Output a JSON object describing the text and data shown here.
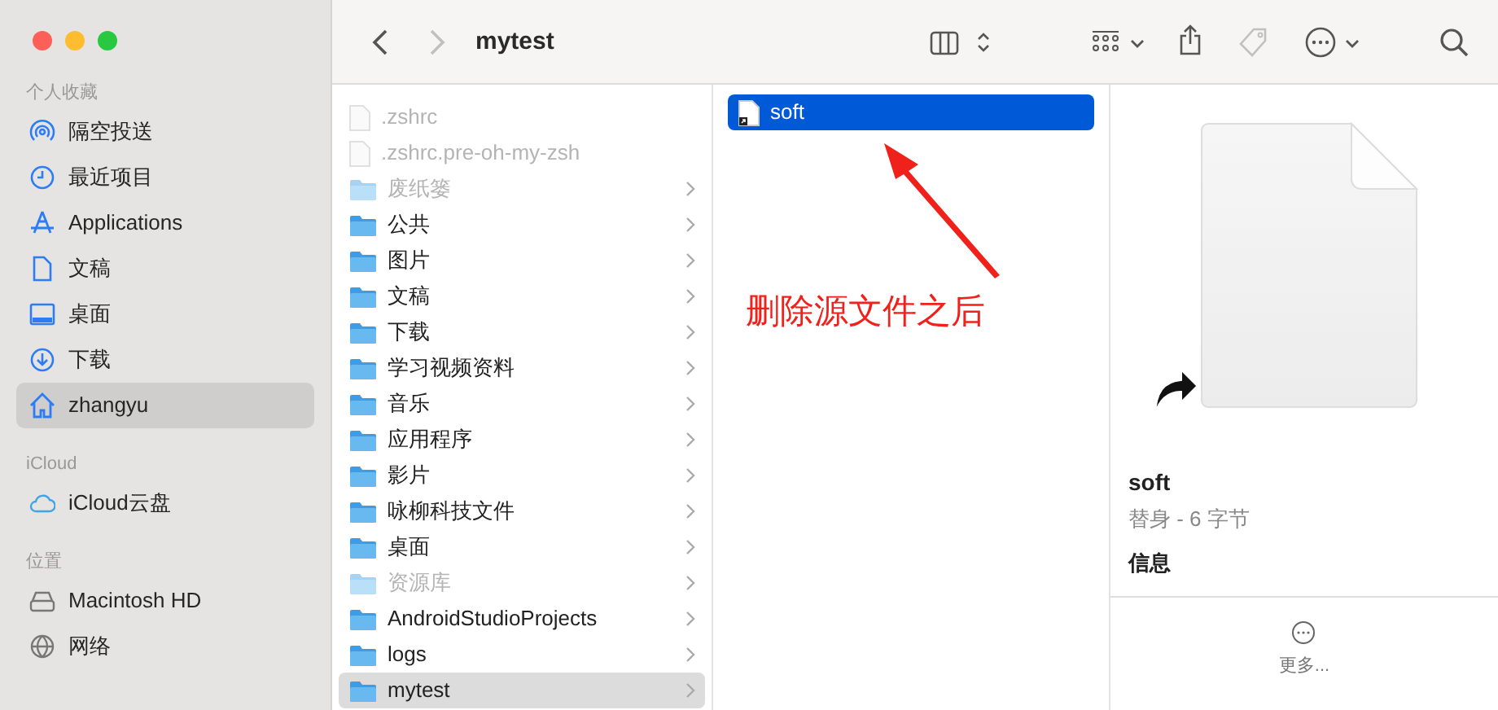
{
  "window": {
    "title": "mytest"
  },
  "toolbar": {
    "back_disabled": false,
    "forward_disabled": true,
    "tags_disabled": true
  },
  "sidebar": {
    "sections": [
      {
        "title": "个人收藏",
        "items": [
          {
            "label": "隔空投送",
            "kind": "airdrop",
            "selected": false
          },
          {
            "label": "最近项目",
            "kind": "clock",
            "selected": false
          },
          {
            "label": "Applications",
            "kind": "apps",
            "selected": false
          },
          {
            "label": "文稿",
            "kind": "doc",
            "selected": false
          },
          {
            "label": "桌面",
            "kind": "desktop",
            "selected": false
          },
          {
            "label": "下载",
            "kind": "download",
            "selected": false
          },
          {
            "label": "zhangyu",
            "kind": "home",
            "selected": true
          }
        ]
      },
      {
        "title": "iCloud",
        "items": [
          {
            "label": "iCloud云盘",
            "kind": "cloud",
            "selected": false
          }
        ]
      },
      {
        "title": "位置",
        "items": [
          {
            "label": "Macintosh HD",
            "kind": "disk",
            "selected": false
          },
          {
            "label": "网络",
            "kind": "globe",
            "selected": false
          }
        ]
      }
    ]
  },
  "column_1": [
    {
      "name": ".zshrc",
      "kind": "file",
      "dimmed": true,
      "selected": false
    },
    {
      "name": ".zshrc.pre-oh-my-zsh",
      "kind": "file",
      "dimmed": true,
      "selected": false
    },
    {
      "name": "废纸篓",
      "kind": "folder",
      "dimmed": true,
      "selected": false
    },
    {
      "name": "公共",
      "kind": "folder",
      "dimmed": false,
      "selected": false
    },
    {
      "name": "图片",
      "kind": "folder",
      "dimmed": false,
      "selected": false
    },
    {
      "name": "文稿",
      "kind": "folder",
      "dimmed": false,
      "selected": false
    },
    {
      "name": "下载",
      "kind": "folder",
      "dimmed": false,
      "selected": false
    },
    {
      "name": "学习视频资料",
      "kind": "folder",
      "dimmed": false,
      "selected": false
    },
    {
      "name": "音乐",
      "kind": "folder",
      "dimmed": false,
      "selected": false
    },
    {
      "name": "应用程序",
      "kind": "folder",
      "dimmed": false,
      "selected": false
    },
    {
      "name": "影片",
      "kind": "folder",
      "dimmed": false,
      "selected": false
    },
    {
      "name": "咏柳科技文件",
      "kind": "folder",
      "dimmed": false,
      "selected": false
    },
    {
      "name": "桌面",
      "kind": "folder",
      "dimmed": false,
      "selected": false
    },
    {
      "name": "资源库",
      "kind": "folder",
      "dimmed": true,
      "selected": false
    },
    {
      "name": "AndroidStudioProjects",
      "kind": "folder",
      "dimmed": false,
      "selected": false
    },
    {
      "name": "logs",
      "kind": "folder",
      "dimmed": false,
      "selected": false
    },
    {
      "name": "mytest",
      "kind": "folder",
      "dimmed": false,
      "selected": true
    }
  ],
  "column_2": [
    {
      "name": "soft",
      "kind": "alias",
      "selected": true
    }
  ],
  "annotation": {
    "text": "删除源文件之后"
  },
  "preview": {
    "name": "soft",
    "subtitle": "替身 - 6 字节",
    "section": "信息",
    "more_label": "更多..."
  }
}
